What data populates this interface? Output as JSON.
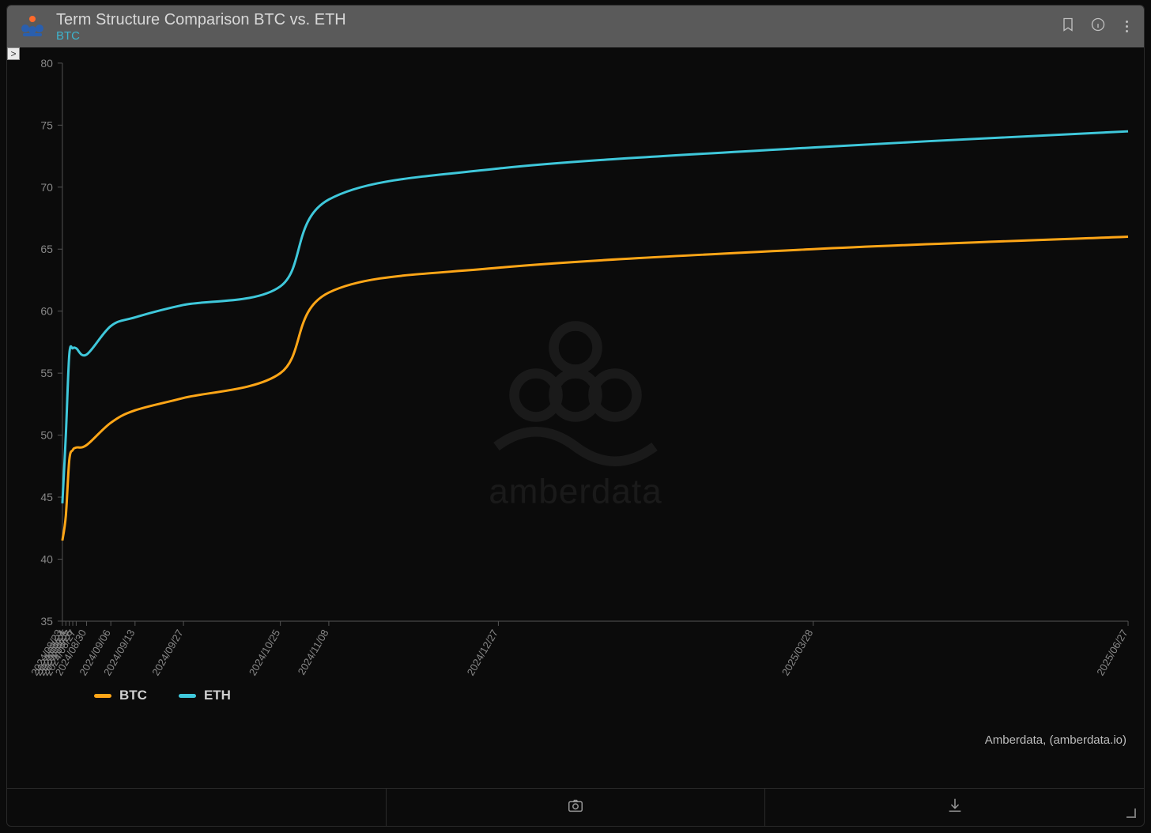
{
  "header": {
    "title": "Term Structure Comparison BTC vs. ETH",
    "subtitle": "BTC"
  },
  "expand_glyph": ">",
  "legend": {
    "btc": "BTC",
    "eth": "ETH"
  },
  "attribution": "Amberdata, (amberdata.io)",
  "watermark": "amberdata",
  "colors": {
    "btc": "#ffa617",
    "eth": "#3fc8db"
  },
  "chart_data": {
    "type": "line",
    "title": "Term Structure Comparison BTC vs. ETH",
    "xlabel": "",
    "ylabel": "",
    "ylim": [
      35,
      80
    ],
    "x_categories": [
      "2024/08/23",
      "2024/08/24",
      "2024/08/25",
      "2024/08/26",
      "2024/08/27",
      "2024/08/30",
      "2024/09/06",
      "2024/09/13",
      "2024/09/27",
      "2024/10/25",
      "2024/11/08",
      "2024/12/27",
      "2025/03/28",
      "2025/06/27"
    ],
    "y_ticks": [
      35,
      40,
      45,
      50,
      55,
      60,
      65,
      70,
      75,
      80
    ],
    "series": [
      {
        "name": "BTC",
        "color": "#ffa617",
        "values": [
          41.5,
          43.5,
          48.0,
          48.8,
          49.0,
          49.2,
          51.0,
          52.0,
          53.0,
          55.0,
          61.5,
          63.5,
          65.0,
          66.0
        ]
      },
      {
        "name": "ETH",
        "color": "#3fc8db",
        "values": [
          44.5,
          50.0,
          56.5,
          57.0,
          57.0,
          56.5,
          58.8,
          59.5,
          60.5,
          62.0,
          69.0,
          71.5,
          73.2,
          74.5
        ]
      }
    ],
    "x_tick_labels_visible": [
      "2024/08/30",
      "2024/09/06",
      "2024/09/13",
      "2024/09/27",
      "2024/10/25",
      "2024/11/08",
      "2024/12/27",
      "2025/03/28",
      "2025/06/27"
    ]
  }
}
